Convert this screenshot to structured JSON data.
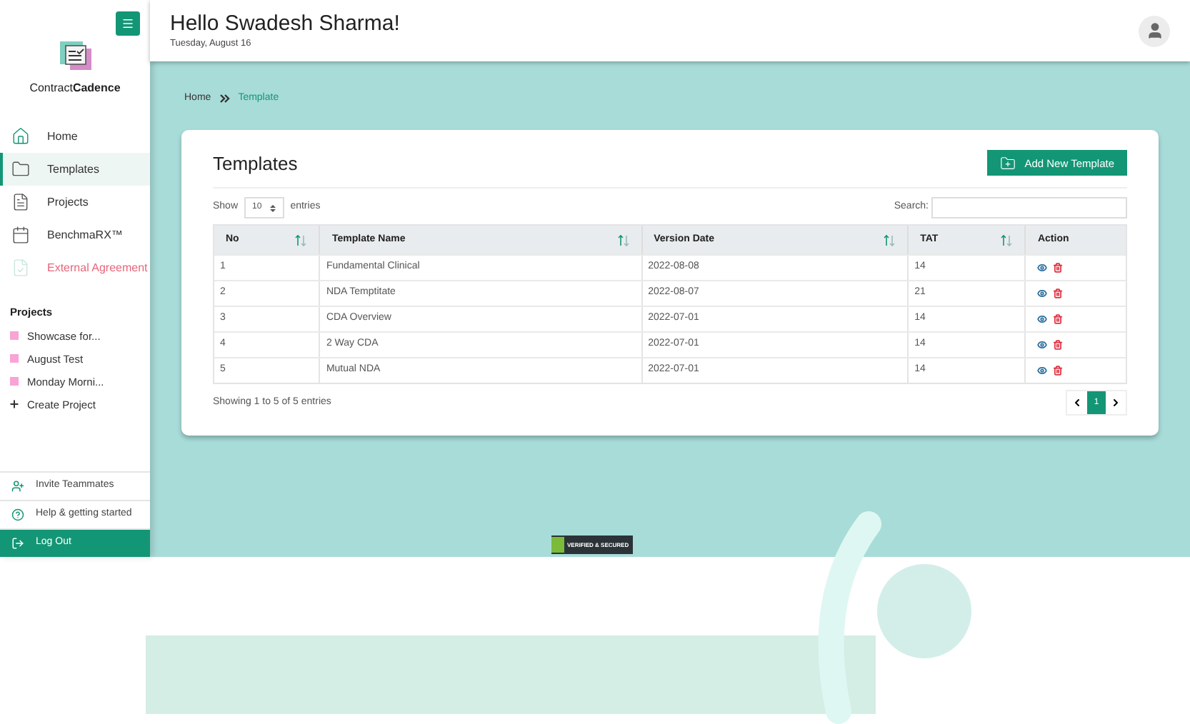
{
  "sidebar": {
    "brand": {
      "light": "Contract",
      "bold": "Cadence"
    },
    "nav": [
      {
        "label": "Home",
        "kind": "home",
        "selected": false
      },
      {
        "label": "Templates",
        "kind": "folder",
        "selected": true
      },
      {
        "label": "Projects",
        "kind": "file",
        "selected": false
      },
      {
        "label": "BenchmaRX™",
        "kind": "calendar",
        "selected": false
      },
      {
        "label": "External Agreement",
        "kind": "external",
        "selected": false
      }
    ],
    "projects_heading": "Projects",
    "projects": [
      {
        "label": "Showcase for...",
        "color": "#f9a3d6"
      },
      {
        "label": "August Test",
        "color": "#f9a3d6"
      },
      {
        "label": "Monday Morni...",
        "color": "#f9a3d6"
      }
    ],
    "create_project": "Create Project",
    "footer": [
      {
        "label": "Invite Teammates",
        "kind": "invite"
      },
      {
        "label": "Help & getting started",
        "kind": "help"
      },
      {
        "label": "Log Out",
        "kind": "logout"
      }
    ]
  },
  "header": {
    "greeting": "Hello Swadesh Sharma!",
    "date": "Tuesday, August 16"
  },
  "breadcrumb": [
    "Home",
    "Template"
  ],
  "card": {
    "title": "Templates",
    "add_button": "Add New Template",
    "show_label": "Show",
    "page_size": "10",
    "entries_label": "entries",
    "search_label": "Search:",
    "columns": [
      {
        "label": "No",
        "sortable": true
      },
      {
        "label": "Template Name",
        "sortable": true
      },
      {
        "label": "Version Date",
        "sortable": true
      },
      {
        "label": "TAT",
        "sortable": true
      },
      {
        "label": "Action",
        "sortable": false
      }
    ],
    "rows": [
      [
        "1",
        "Fundamental Clinical",
        "2022-08-08",
        "14"
      ],
      [
        "2",
        "NDA Temptitate",
        "2022-08-07",
        "21"
      ],
      [
        "3",
        "CDA Overview",
        "2022-07-01",
        "14"
      ],
      [
        "4",
        "2 Way CDA",
        "2022-07-01",
        "14"
      ],
      [
        "5",
        "Mutual NDA",
        "2022-07-01",
        "14"
      ]
    ],
    "info": "Showing 1 to 5 of 5 entries",
    "pages": [
      {
        "label": "1",
        "selected": true
      }
    ]
  },
  "seal": "VERIFIED & SECURED"
}
